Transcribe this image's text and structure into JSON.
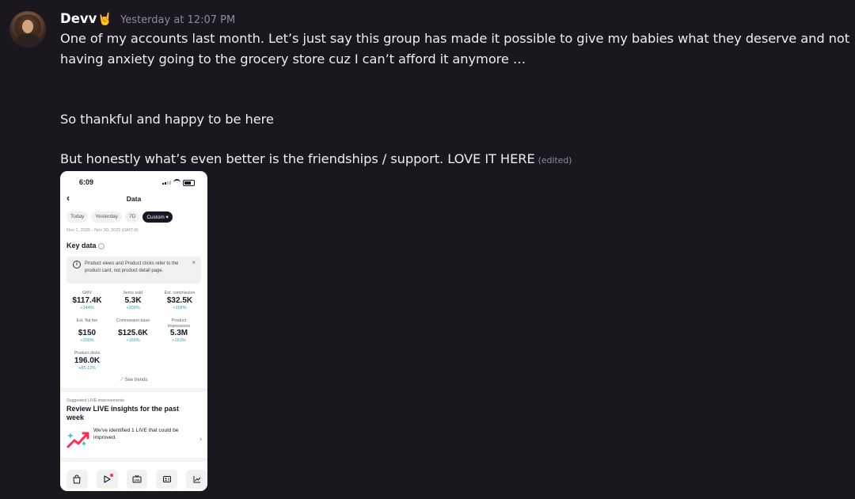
{
  "message": {
    "author": "Devv",
    "author_emoji": "🤘",
    "timestamp": "Yesterday at 12:07 PM",
    "lines": [
      "One of my accounts last month. Let’s just say this group has made it possible to give my babies what they deserve and not",
      "having anxiety going to the grocery store cuz I can’t afford it anymore …",
      "So thankful and happy to be here",
      "But honestly what’s even better is the friendships / support.  LOVE IT HERE"
    ],
    "edited_label": "(edited)"
  },
  "attachment": {
    "status_time": "6:09",
    "page_title": "Data",
    "date_tabs": [
      "Today",
      "Yesterday",
      "7D",
      "Custom"
    ],
    "active_tab": "Custom",
    "date_range": "Nov 1, 2025 - Nov 30, 2025 (GMT-8)",
    "key_data_title": "Key data",
    "notice_text": "Product views and Product clicks refer to the product card, not product detail page.",
    "metrics": [
      {
        "label": "GMV",
        "value": "$117.4K",
        "change": "+144%"
      },
      {
        "label": "Items sold",
        "value": "5.3K",
        "change": "+208%"
      },
      {
        "label": "Est. commission",
        "value": "$32.5K",
        "change": "+158%"
      },
      {
        "label": "Est. flat fee",
        "value": "$150",
        "change": "+200%"
      },
      {
        "label": "Commission base",
        "value": "$125.6K",
        "change": "+165%"
      },
      {
        "label": "Product impressions",
        "value": "5.3M",
        "change": "+163%"
      },
      {
        "label": "Product clicks",
        "value": "196.0K",
        "change": "+85.12%"
      }
    ],
    "see_trends": "See trends",
    "suggestion": {
      "label": "Suggested LIVE improvements",
      "title": "Review LIVE insights for the past week",
      "text": "We've identified 1 LIVE that could be improved."
    },
    "bottom_icons": [
      "shop-bag-icon",
      "play-icon",
      "live-icon",
      "id-card-icon",
      "chart-icon"
    ]
  }
}
